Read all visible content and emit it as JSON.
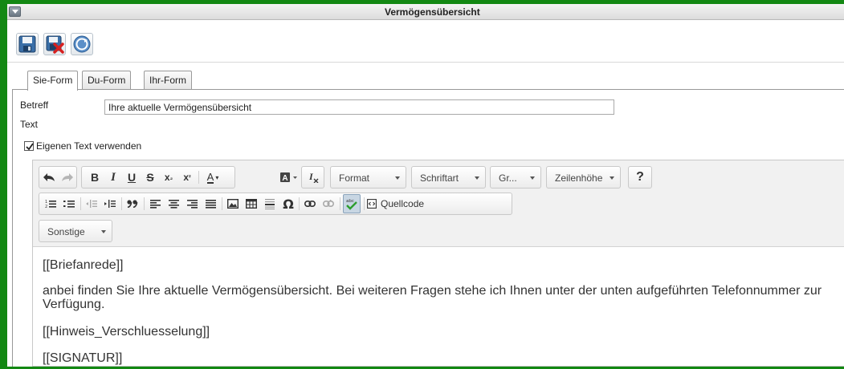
{
  "window": {
    "title": "Vermögensübersicht"
  },
  "toolbar": {
    "buttons": [
      {
        "name": "save-icon"
      },
      {
        "name": "delete-icon"
      },
      {
        "name": "refresh-icon"
      }
    ]
  },
  "tabs": [
    {
      "label": "Sie-Form",
      "active": true
    },
    {
      "label": "Du-Form",
      "active": false
    },
    {
      "label": "Ihr-Form",
      "active": false
    }
  ],
  "form": {
    "subject_label": "Betreff",
    "subject_value": "Ihre aktuelle Vermögensübersicht",
    "text_label": "Text",
    "own_text_label": "Eigenen Text verwenden",
    "own_text_checked": true
  },
  "editor": {
    "format_label": "Format",
    "font_label": "Schriftart",
    "size_label": "Gr...",
    "line_height_label": "Zeilenhöhe",
    "help_label": "?",
    "source_label": "Quellcode",
    "misc_label": "Sonstige",
    "content": [
      "[[Briefanrede]]",
      "anbei finden Sie Ihre aktuelle Vermögensübersicht. Bei weiteren Fragen stehe ich Ihnen unter der unten aufgeführten Telefonnummer zur Verfügung.",
      "[[Hinweis_Verschluesselung]]",
      "[[SIGNATUR]]"
    ]
  },
  "colors": {
    "frame": "#138813",
    "editor_toolbar_bg": "#f1f1f1"
  }
}
